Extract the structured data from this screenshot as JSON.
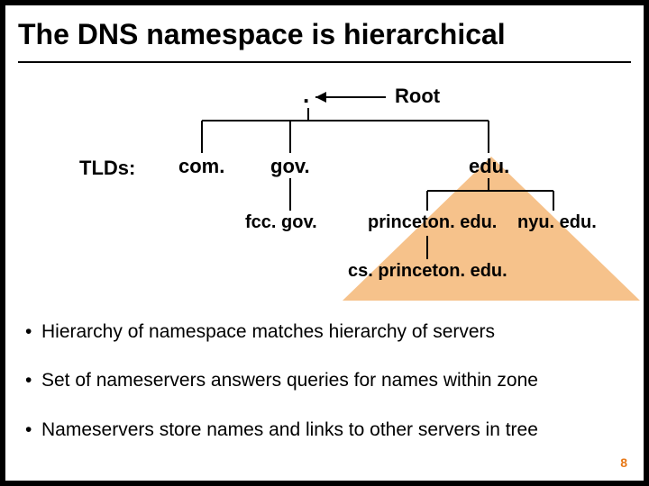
{
  "title": "The DNS namespace is hierarchical",
  "diagram": {
    "root_dot": ".",
    "root_label": "Root",
    "tlds_label": "TLDs:",
    "tlds": {
      "com": "com.",
      "gov": "gov.",
      "edu": "edu."
    },
    "second_level": {
      "fcc": "fcc. gov.",
      "princeton": "princeton. edu.",
      "nyu": "nyu. edu."
    },
    "third_level": {
      "cs_princeton": "cs. princeton. edu."
    }
  },
  "bullets": [
    "Hierarchy of namespace matches hierarchy of servers",
    "Set of nameservers answers queries for names within zone",
    "Nameservers store names and links to other servers in tree"
  ],
  "page_number": "8"
}
